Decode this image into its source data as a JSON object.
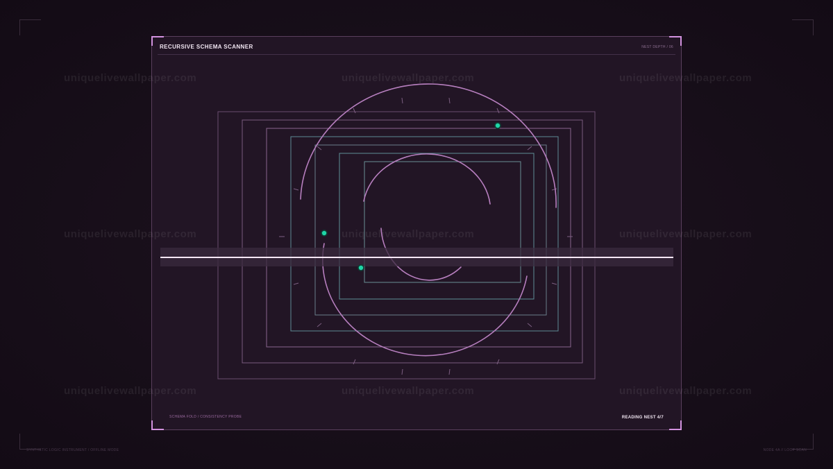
{
  "panel": {
    "title": "RECURSIVE SCHEMA SCANNER",
    "meta": "NEST DEPTH / 06",
    "footer_left": "SCHEMA FOLD / CONSISTENCY PROBE",
    "footer_right": "READING NEST 4/7"
  },
  "frame": {
    "footer_left": "SYNTHETIC LOGIC INSTRUMENT / OFFLINE MODE",
    "footer_right": "NODE 4A // LOOP SCAN"
  },
  "watermark": {
    "text": "uniquelivewallpaper.com"
  },
  "scanner": {
    "nest_depth": 6,
    "reading_nest": 4,
    "total_nests": 7
  },
  "colors": {
    "background": "#170e19",
    "panel": "#221525",
    "accent": "#d392e0",
    "nest_frame_pink": "#7a5a80",
    "nest_frame_teal": "#5a8a92",
    "arc": "#b77fbf",
    "node": "#1fd6a8",
    "scan_line": "#f6e8f6"
  },
  "icons": {
    "node": "teal-node-dot",
    "corner": "corner-bracket"
  }
}
